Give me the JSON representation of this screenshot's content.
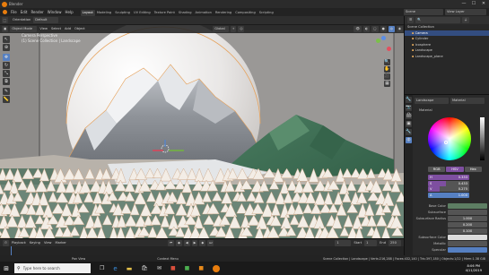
{
  "window": {
    "title": "Blender",
    "minimize": "—",
    "maximize": "☐",
    "close": "✕"
  },
  "menubar": {
    "items": [
      "File",
      "Edit",
      "Render",
      "Window",
      "Help"
    ],
    "workspaces": [
      "Layout",
      "Modeling",
      "Sculpting",
      "UV Editing",
      "Texture Paint",
      "Shading",
      "Animation",
      "Rendering",
      "Compositing",
      "Scripting"
    ],
    "active_workspace": "Layout",
    "scene_label": "Scene",
    "view_layer_label": "View Layer"
  },
  "toolheader": {
    "transform_label": "Orientation",
    "orientation_value": "Default",
    "mode": "Object Mode",
    "menus": [
      "View",
      "Select",
      "Add",
      "Object"
    ],
    "global_label": "Global"
  },
  "viewport": {
    "perspective_label": "Camera Perspective",
    "collection_label": "(1) Scene Collection | Landscape"
  },
  "outliner": {
    "header": "Scene Collection",
    "rows": [
      "Camera",
      "Cylinder",
      "Icosphere",
      "Landscape",
      "Landscape_plane"
    ],
    "selected_index": 0
  },
  "properties": {
    "tab_object": "Landscape",
    "tab_material": "Material",
    "material_slot": "Material",
    "color_mode_tabs": [
      "RGB",
      "HSV",
      "Hex"
    ],
    "active_color_mode": "HSV",
    "channels": [
      {
        "label": "H",
        "value": "0.333"
      },
      {
        "label": "S",
        "value": "0.433"
      },
      {
        "label": "V",
        "value": "0.275"
      },
      {
        "label": "A",
        "value": "1.000"
      }
    ],
    "fields": [
      {
        "label": "Base Color",
        "value": ""
      },
      {
        "label": "Subsurface",
        "value": ""
      },
      {
        "label": "Subsurface Radius",
        "value": "1.000"
      },
      {
        "label": "",
        "value": "0.200"
      },
      {
        "label": "",
        "value": "0.100"
      },
      {
        "label": "Subsurface Color",
        "value": ""
      },
      {
        "label": "Metallic",
        "value": ""
      },
      {
        "label": "Specular",
        "value": ""
      }
    ]
  },
  "timeline": {
    "menus": [
      "Playback",
      "Keying",
      "View",
      "Marker"
    ],
    "current_frame": "1",
    "start_label": "Start",
    "start_value": "1",
    "end_label": "End",
    "end_value": "250"
  },
  "statusbar": {
    "left": "Pan View",
    "middle": "Context Menu",
    "right": "Scene Collection | Landscape | Verts:216,288 | Faces:432,140 | Tris:397,180 | Objects:1/22 | Mem:1.38 GiB"
  },
  "taskbar": {
    "search_placeholder": "Type here to search",
    "time": "8:06 PM",
    "date": "4/11/2019"
  },
  "colors": {
    "accent": "#5680c2",
    "selection": "#334d80",
    "hsv_active": "#7e4fa0",
    "planet": "#e8e6e4",
    "mountain_gray": "#8a8d92",
    "green_hill": "#3f6e54",
    "ground": "#5e7a6a"
  }
}
